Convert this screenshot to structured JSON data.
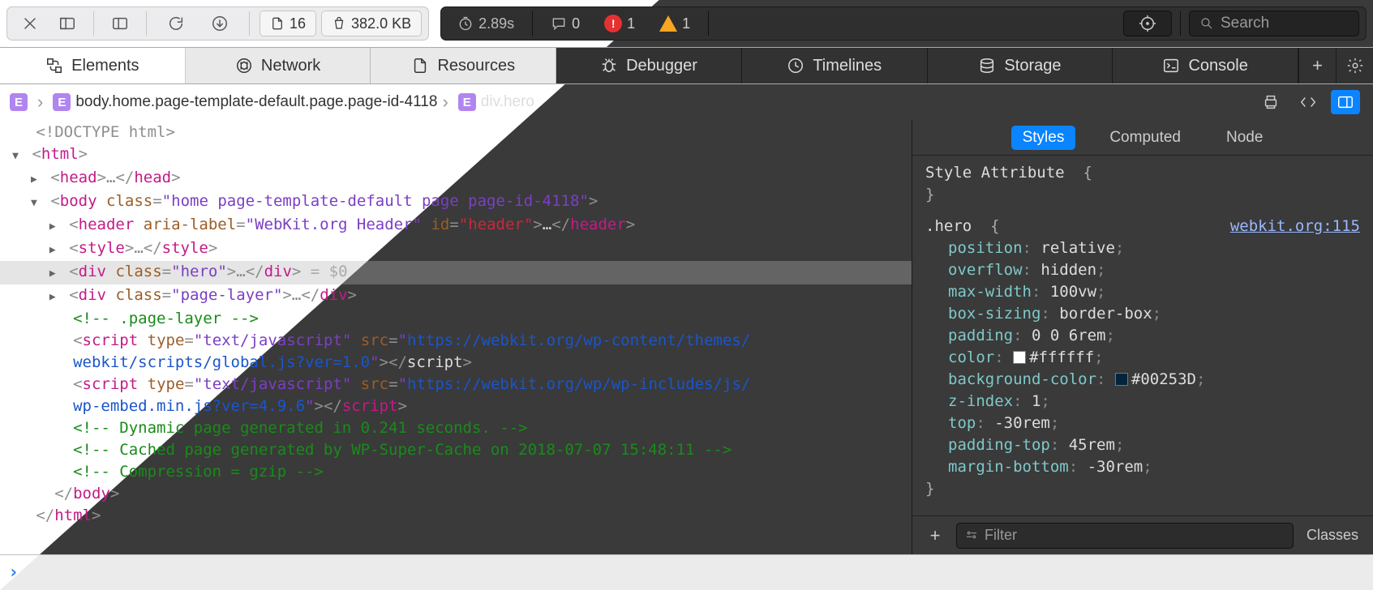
{
  "toolbar": {
    "file_count": "16",
    "size": "382.0 KB",
    "time": "2.89s",
    "messages": "0",
    "errors": "1",
    "warnings": "1",
    "search_placeholder": "Search"
  },
  "tabs": [
    {
      "id": "elements",
      "label": "Elements"
    },
    {
      "id": "network",
      "label": "Network"
    },
    {
      "id": "resources",
      "label": "Resources"
    },
    {
      "id": "debugger",
      "label": "Debugger"
    },
    {
      "id": "timelines",
      "label": "Timelines"
    },
    {
      "id": "storage",
      "label": "Storage"
    },
    {
      "id": "console",
      "label": "Console"
    }
  ],
  "breadcrumb": {
    "path": "body.home.page-template-default.page.page-id-4118",
    "selected": "div.hero"
  },
  "dom": {
    "doctype": "<!DOCTYPE html>",
    "html_open": "html",
    "head_collapsed": "…",
    "body_class": "home page-template-default page page-id-4118",
    "header_aria": "WebKit.org Header",
    "header_id": "header",
    "hero_class": "hero",
    "page_layer_class": "page-layer",
    "comment_page_layer": "<!-- .page-layer -->",
    "script1_type": "text/javascript",
    "script1_src_a": "https://webkit.org/wp-content/themes/",
    "script1_src_b": "webkit/scripts/global.js?ver=1.0",
    "script2_type": "text/javascript",
    "script2_src_a": "https://webkit.org/wp/wp-includes/js/",
    "script2_src_b": "wp-embed.min.js?ver=4.9.6",
    "comment_dyn": "<!-- Dynamic page generated in 0.241 seconds. -->",
    "comment_cache": "<!-- Cached page generated by WP-Super-Cache on 2018-07-07 15:48:11 -->",
    "comment_gzip": "<!-- Compression = gzip -->",
    "selected_suffix": " = $0"
  },
  "styles": {
    "tabs": {
      "styles": "Styles",
      "computed": "Computed",
      "node": "Node"
    },
    "style_attr_label": "Style Attribute",
    "rule": {
      "selector": ".hero",
      "source": "webkit.org:115",
      "decls": [
        {
          "p": "position",
          "v": "relative"
        },
        {
          "p": "overflow",
          "v": "hidden"
        },
        {
          "p": "max-width",
          "v": "100vw"
        },
        {
          "p": "box-sizing",
          "v": "border-box"
        },
        {
          "p": "padding",
          "v": "0 0 6rem"
        },
        {
          "p": "color",
          "v": "#ffffff",
          "sw": "#ffffff"
        },
        {
          "p": "background-color",
          "v": "#00253D",
          "sw": "#00253D"
        },
        {
          "p": "z-index",
          "v": "1"
        },
        {
          "p": "top",
          "v": "-30rem"
        },
        {
          "p": "padding-top",
          "v": "45rem"
        },
        {
          "p": "margin-bottom",
          "v": "-30rem"
        }
      ]
    },
    "filter_placeholder": "Filter",
    "classes_label": "Classes"
  }
}
